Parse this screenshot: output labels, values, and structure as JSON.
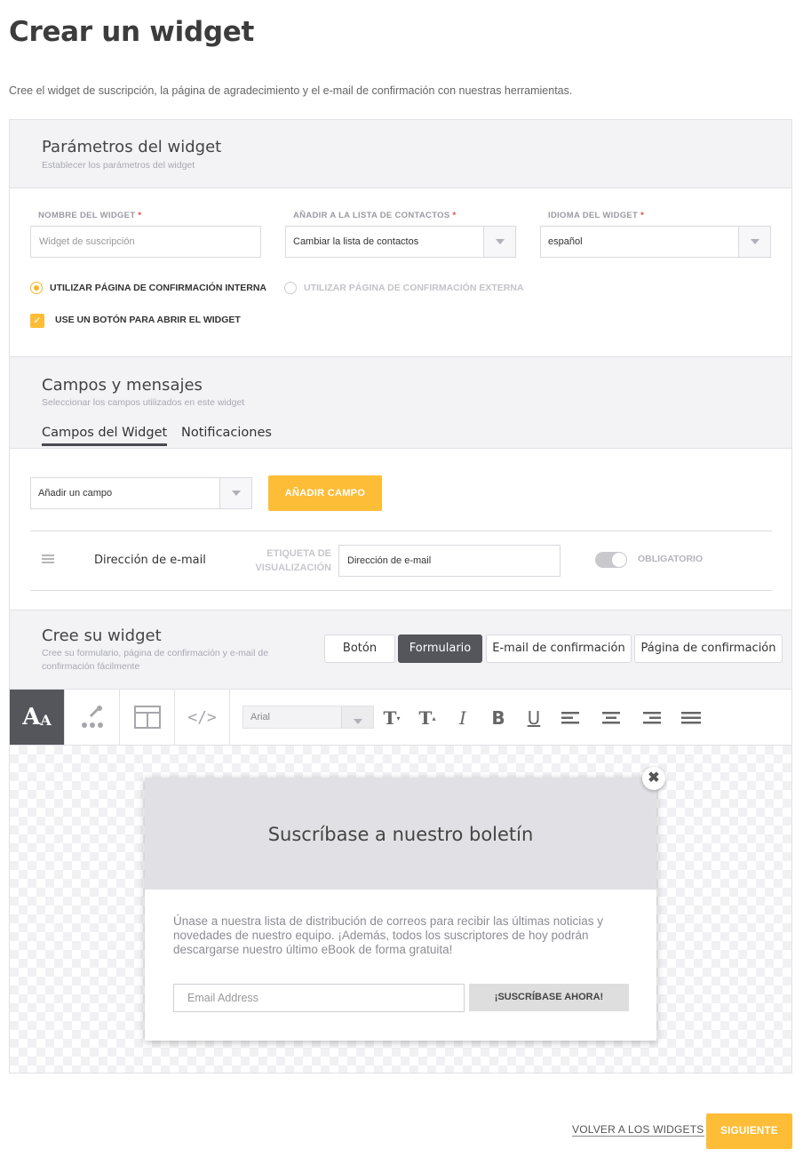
{
  "page": {
    "title": "Crear un widget",
    "intro": "Cree el widget de suscripción, la página de agradecimiento y el e-mail de confirmación con nuestras herramientas."
  },
  "params": {
    "title": "Parámetros del widget",
    "subtitle": "Establecer los parámetros del widget",
    "name_label": "NOMBRE DEL WIDGET",
    "name_placeholder": "Widget de suscripción",
    "list_label": "AÑADIR A LA LISTA DE CONTACTOS",
    "list_value": "Cambiar la lista de contactos",
    "lang_label": "IDIOMA DEL WIDGET",
    "lang_value": "español",
    "required_mark": "*",
    "radio_internal": "UTILIZAR PÁGINA DE CONFIRMACIÓN INTERNA",
    "radio_external": "UTILIZAR PÁGINA DE CONFIRMACIÓN EXTERNA",
    "checkbox_label": "USE UN BOTÓN PARA ABRIR EL WIDGET"
  },
  "fields": {
    "title": "Campos y mensajes",
    "subtitle": "Seleccionar los campos utilizados en este widget",
    "tabs": [
      {
        "label": "Campos del Widget",
        "active": true
      },
      {
        "label": "Notificaciones",
        "active": false
      }
    ],
    "add_field_select": "Añadir un campo",
    "add_field_button": "AÑADIR CAMPO",
    "row": {
      "name": "Dirección de e-mail",
      "display_label_1": "ETIQUETA DE",
      "display_label_2": "VISUALIZACIÓN",
      "display_value": "Dirección de e-mail",
      "required_label": "OBLIGATORIO"
    }
  },
  "builder": {
    "title": "Cree su widget",
    "subtitle": "Cree su formulario, página de confirmación y e-mail de confirmación fácilmente",
    "modes": [
      {
        "label": "Botón",
        "active": false
      },
      {
        "label": "Formulario",
        "active": true
      },
      {
        "label": "E-mail de confirmación",
        "active": false
      },
      {
        "label": "Página de confirmación",
        "active": false
      }
    ],
    "toolbar": {
      "tools": [
        "text-style-icon",
        "paint-dropper-icon",
        "layout-icon",
        "code-icon"
      ],
      "font_value": "Arial",
      "format_icons": [
        "font-size-decrease-icon",
        "font-size-increase-icon",
        "italic-icon",
        "bold-icon",
        "underline-icon",
        "align-left-icon",
        "align-center-icon",
        "align-right-icon",
        "align-justify-icon"
      ]
    },
    "preview": {
      "heading": "Suscríbase a nuestro boletín",
      "text": "Únase a nuestra lista de distribución de correos para recibir las últimas noticias y novedades de nuestro equipo. ¡Además, todos los suscriptores de hoy podrán descargarse nuestro último eBook de forma gratuita!",
      "email_placeholder": "Email Address",
      "submit_label": "¡SUSCRÍBASE AHORA!",
      "close_glyph": "✖"
    }
  },
  "footer": {
    "back_label": "VOLVER A LOS WIDGETS",
    "next_label": "SIGUIENTE"
  },
  "colors": {
    "accent": "#fdbd37",
    "dark_button": "#55565c",
    "required": "#e8453c"
  }
}
